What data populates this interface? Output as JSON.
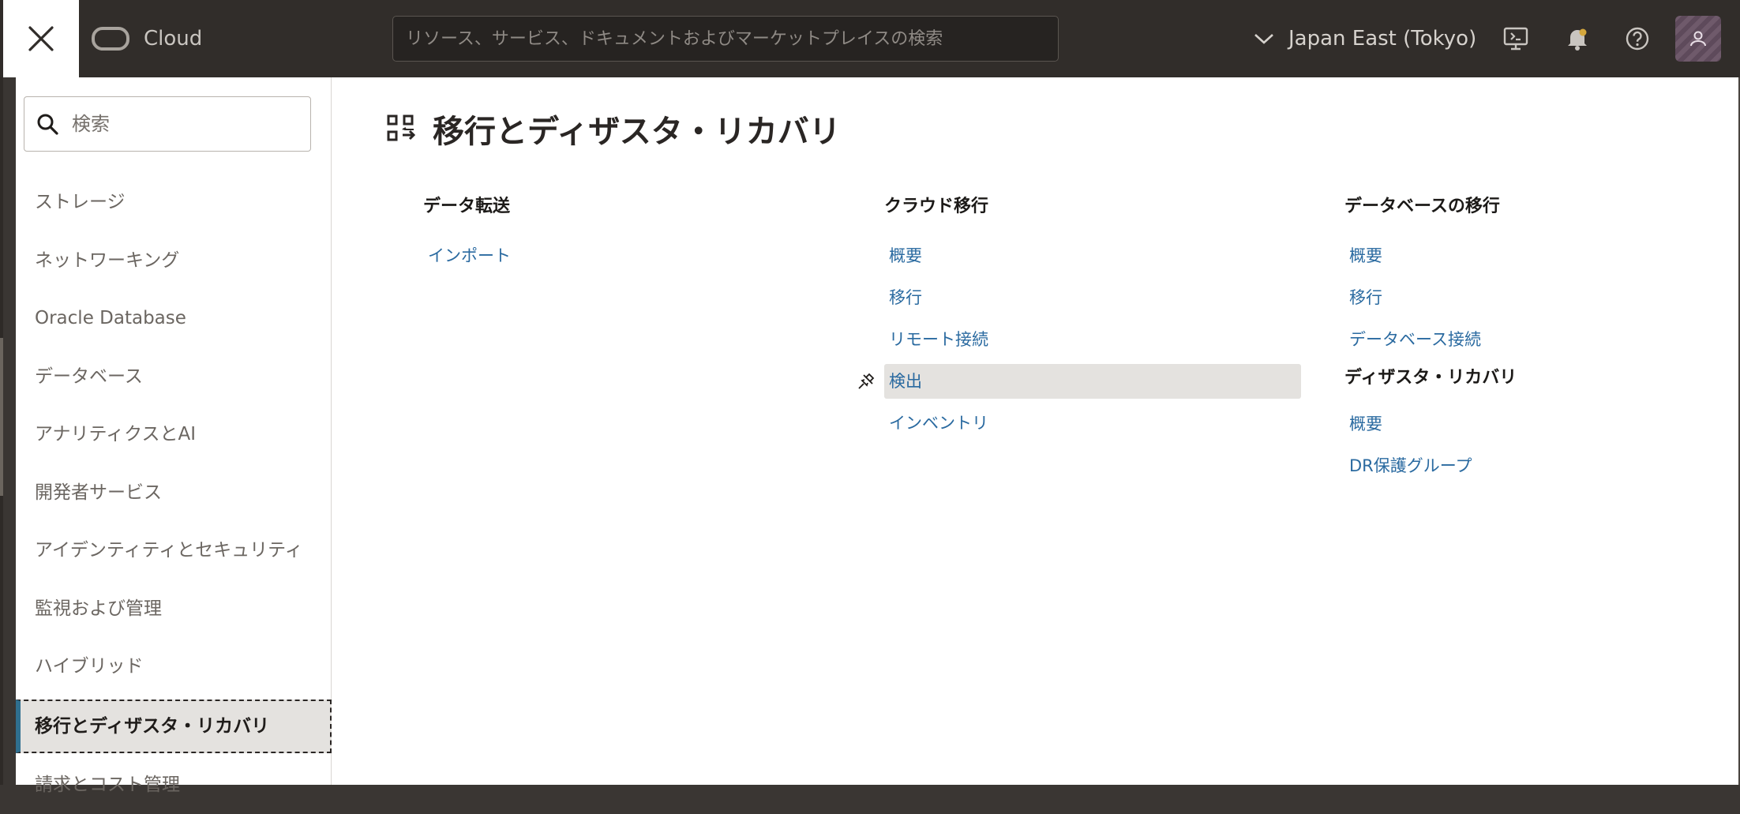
{
  "header": {
    "brand": "Cloud",
    "search_placeholder": "リソース、サービス、ドキュメントおよびマーケットプレイスの検索",
    "region": "Japan East (Tokyo)"
  },
  "sidebar": {
    "search_placeholder": "検索",
    "items": [
      {
        "label": "ストレージ"
      },
      {
        "label": "ネットワーキング"
      },
      {
        "label": "Oracle Database"
      },
      {
        "label": "データベース"
      },
      {
        "label": "アナリティクスとAI"
      },
      {
        "label": "開発者サービス"
      },
      {
        "label": "アイデンティティとセキュリティ"
      },
      {
        "label": "監視および管理"
      },
      {
        "label": "ハイブリッド"
      },
      {
        "label": "移行とディザスタ・リカバリ",
        "active": true
      },
      {
        "label": "請求とコスト管理"
      }
    ]
  },
  "main": {
    "title": "移行とディザスタ・リカバリ",
    "columns": [
      {
        "heading": "データ転送",
        "links": [
          "インポート"
        ]
      },
      {
        "heading": "クラウド移行",
        "links": [
          "概要",
          "移行",
          "リモート接続",
          "検出",
          "インベントリ"
        ],
        "hover_index": 3
      },
      {
        "heading": "データベースの移行",
        "links": [
          "概要",
          "移行",
          "データベース接続"
        ],
        "sub_heading": "ディザスタ・リカバリ",
        "sub_links": [
          "概要",
          "DR保護グループ"
        ]
      }
    ]
  },
  "colors": {
    "header_bg": "#312d2a",
    "link": "#2a6aa0",
    "active_accent": "#2f6f8f"
  }
}
